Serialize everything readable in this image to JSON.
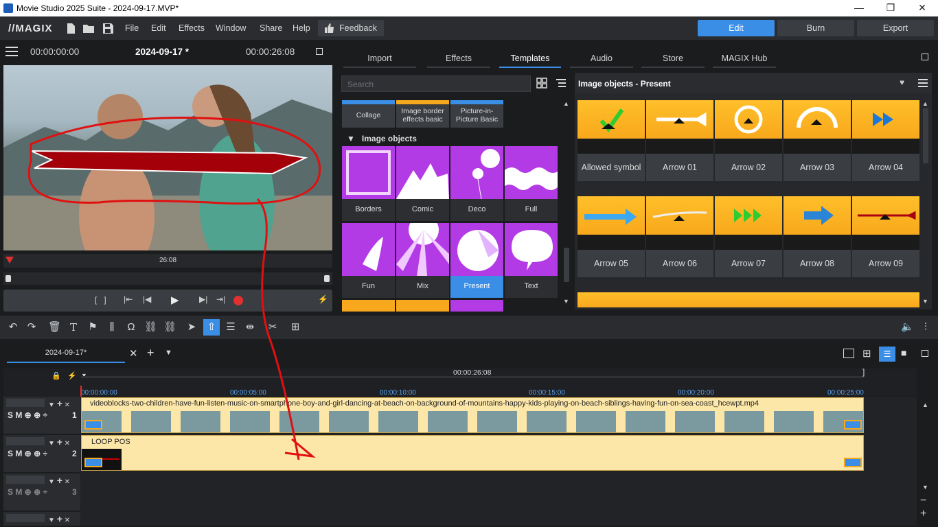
{
  "window": {
    "title": "Movie Studio 2025 Suite - 2024-09-17.MVP*",
    "min": "—",
    "max": "❐",
    "close": "✕"
  },
  "menubar": {
    "logo": "//MAGIX",
    "menus": [
      "File",
      "Edit",
      "Effects",
      "Window",
      "Share",
      "Help"
    ],
    "feedback": "Feedback",
    "modes": [
      "Edit",
      "Burn",
      "Export"
    ],
    "active_mode": "Edit"
  },
  "preview": {
    "timecode_left": "00:00:00:00",
    "project": "2024-09-17 *",
    "timecode_right": "00:00:26:08",
    "scrub_time": "26:08"
  },
  "media": {
    "tabs": [
      "Import",
      "Effects",
      "Templates",
      "Audio",
      "Store",
      "MAGIX Hub"
    ],
    "active_tab": "Templates",
    "search_placeholder": "Search",
    "categories": [
      "Collage",
      "Image border effects basic",
      "Picture-in-Picture Basic"
    ],
    "section": "Image objects",
    "tiles": [
      "Borders",
      "Comic",
      "Deco",
      "Full",
      "Fun",
      "Mix",
      "Present",
      "Text"
    ],
    "selected_tile": "Present",
    "objects_title": "Image objects - Present",
    "objects": [
      "Allowed symbol",
      "Arrow 01",
      "Arrow 02",
      "Arrow 03",
      "Arrow 04",
      "Arrow 05",
      "Arrow 06",
      "Arrow 07",
      "Arrow 08",
      "Arrow 09"
    ]
  },
  "timeline": {
    "tab": "2024-09-17*",
    "ruler_center": "00:00:26:08",
    "ruler_ticks": [
      "00:00:00:00",
      "00:00:05:00",
      "00:00:10:00",
      "00:00:15:00",
      "00:00:20:00",
      "00:00:25:00"
    ],
    "tracks": [
      {
        "num": "1",
        "controls": "S M",
        "clip": "videoblocks-two-children-have-fun-listen-music-on-smartphone-boy-and-girl-dancing-at-beach-on-background-of-mountains-happy-kids-playing-on-beach-siblings-having-fun-on-sea-coast_hcewpt.mp4"
      },
      {
        "num": "2",
        "controls": "S M",
        "clip": "LOOP POS"
      },
      {
        "num": "3",
        "controls": "S M",
        "clip": ""
      }
    ]
  },
  "colors": {
    "accent": "#3b8ee6",
    "clip": "#fde7a8",
    "purple": "#b33be6",
    "orange": "#ffb628"
  }
}
